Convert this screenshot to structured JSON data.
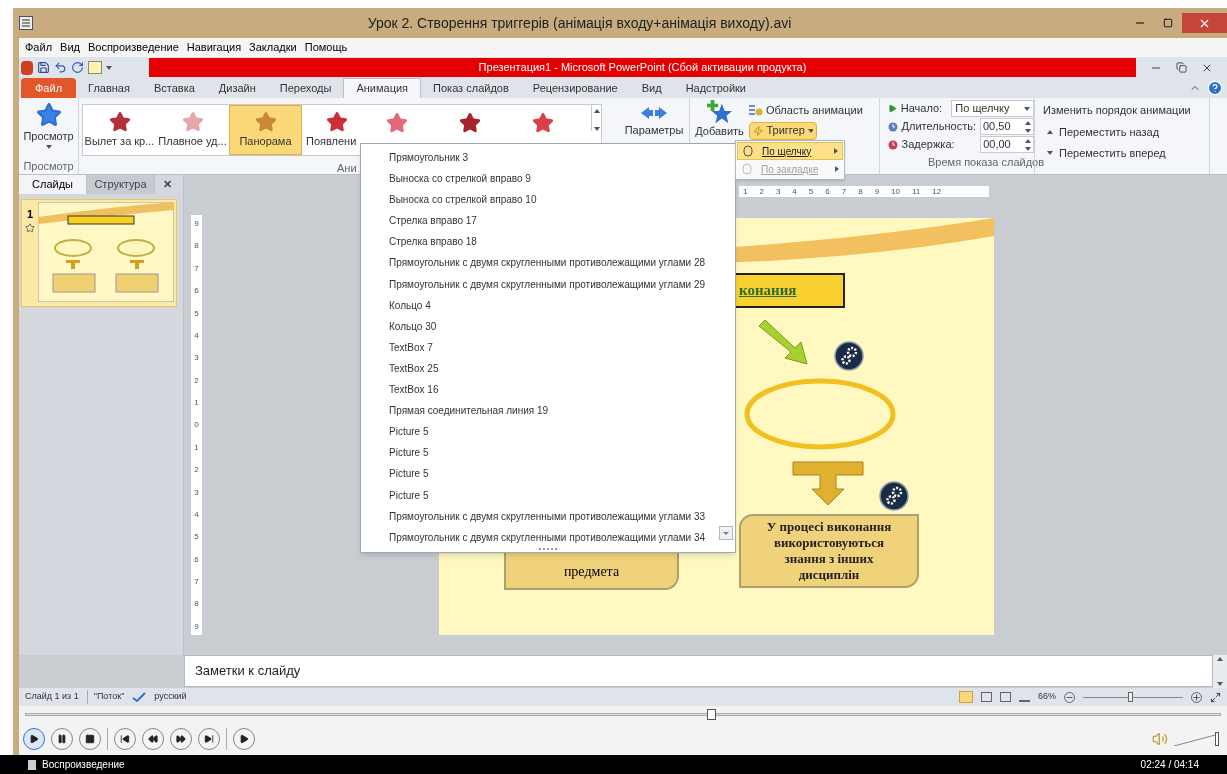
{
  "player": {
    "title": "Урок 2. Створення триггерів (анімація входу+анімація виходу).avi",
    "menu": [
      "Файл",
      "Вид",
      "Воспроизведение",
      "Навигация",
      "Закладки",
      "Помощь"
    ],
    "seek": {
      "level": 0.57
    },
    "volume": {
      "level": 1
    },
    "status": "Воспроизведение",
    "time": "02:24 / 04:14"
  },
  "powerpoint": {
    "title": "Презентация1  -  Microsoft PowerPoint (Сбой активации продукта)",
    "tabs": [
      {
        "label": "Файл",
        "kind": "file",
        "selected": false
      },
      {
        "label": "Главная",
        "kind": "tab",
        "selected": false
      },
      {
        "label": "Вставка",
        "kind": "tab",
        "selected": false
      },
      {
        "label": "Дизайн",
        "kind": "tab",
        "selected": false
      },
      {
        "label": "Переходы",
        "kind": "tab",
        "selected": false
      },
      {
        "label": "Анимация",
        "kind": "tab",
        "selected": true
      },
      {
        "label": "Показ слайдов",
        "kind": "tab",
        "selected": false
      },
      {
        "label": "Рецензирование",
        "kind": "tab",
        "selected": false
      },
      {
        "label": "Вид",
        "kind": "tab",
        "selected": false
      },
      {
        "label": "Надстройки",
        "kind": "tab",
        "selected": false
      }
    ],
    "ribbon": {
      "preview_button": "Просмотр",
      "preview_group": "Просмотр",
      "gallery": [
        {
          "label": "Вылет за кр...",
          "selected": false
        },
        {
          "label": "Плавное уд...",
          "selected": false
        },
        {
          "label": "Панорама",
          "selected": true
        },
        {
          "label": "Появлени",
          "selected": false
        },
        {
          "selected": false
        },
        {
          "selected": false
        },
        {
          "selected": false
        }
      ],
      "gallery_group": "Ани",
      "parameters": "Параметры",
      "add": "Добавить",
      "animation_pane": "Область анимации",
      "trigger": "Триггер",
      "start_label": "Начало:",
      "start_value": "По щелчку",
      "duration_label": "Длительность:",
      "duration_value": "00,50",
      "delay_label": "Задержка:",
      "delay_value": "00,00",
      "timing_group": "Время показа слайдов",
      "reorder_title": "Изменить порядок анимации",
      "move_back": "Переместить назад",
      "move_forward": "Переместить вперед"
    },
    "trigger_menu": [
      {
        "label": "По щелчку",
        "selected": true,
        "disabled": false
      },
      {
        "label": "По закладке",
        "selected": false,
        "disabled": true
      }
    ],
    "object_list": [
      "Прямоугольник 3",
      "Выноска со стрелкой вправо 9",
      "Выноска со стрелкой вправо 10",
      "Стрелка вправо 17",
      "Стрелка вправо 18",
      "Прямоугольник с двумя скругленными противолежащими углами 28",
      "Прямоугольник с двумя скругленными противолежащими углами 29",
      "Кольцо 4",
      "Кольцо 30",
      "TextBox 7",
      "TextBox 25",
      "TextBox 16",
      "Прямая соединительная линия 19",
      "Picture 5",
      "Picture 5",
      "Picture 5",
      "Picture 5",
      "Прямоугольник с двумя скругленными противолежащими углами 33",
      "Прямоугольник с двумя скругленными противолежащими углами 34"
    ],
    "panel": {
      "tabs": [
        {
          "label": "Слайды",
          "selected": true
        },
        {
          "label": "Структура",
          "selected": false
        }
      ],
      "close": "✕",
      "slide_number": "1"
    },
    "horizontal_ruler": [
      "1",
      "2",
      "3",
      "4",
      "5",
      "6",
      "7",
      "8",
      "9",
      "10",
      "11",
      "12"
    ],
    "vertical_ruler": [
      "9",
      "8",
      "7",
      "6",
      "5",
      "4",
      "3",
      "2",
      "1",
      "0",
      "1",
      "2",
      "3",
      "4",
      "5",
      "6",
      "7",
      "8",
      "9"
    ],
    "slide": {
      "title_fragment": "конания",
      "left_box": "предмета",
      "right_box": "У процесі виконання використовуються знання з інших дисциплін"
    },
    "notes": {
      "placeholder": "Заметки к слайду"
    },
    "status_bar": {
      "slide": "Слайд 1 из 1",
      "theme": "\"Поток\"",
      "language": "русский",
      "zoom": "66%",
      "zoom_slider": {
        "level": 0.47
      }
    }
  }
}
